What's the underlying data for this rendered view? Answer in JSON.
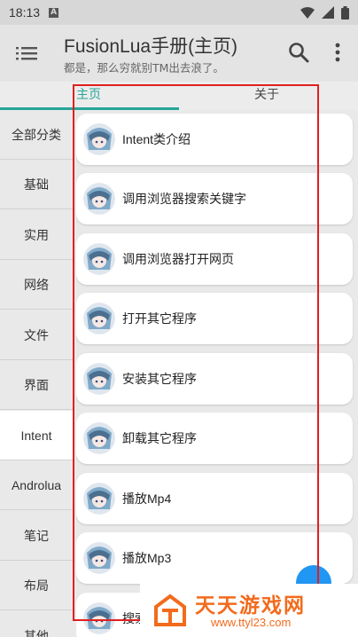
{
  "status_bar": {
    "time": "18:13",
    "sim_label": "A"
  },
  "app_bar": {
    "title": "FusionLua手册(主页)",
    "subtitle": "都是，那么穷就别TM出去浪了。"
  },
  "tabs": [
    {
      "label": "主页",
      "selected": true
    },
    {
      "label": "关于",
      "selected": false
    }
  ],
  "categories": [
    {
      "label": "全部分类"
    },
    {
      "label": "基础"
    },
    {
      "label": "实用"
    },
    {
      "label": "网络"
    },
    {
      "label": "文件"
    },
    {
      "label": "界面"
    },
    {
      "label": "Intent",
      "selected": true
    },
    {
      "label": "Androlua"
    },
    {
      "label": "笔记"
    },
    {
      "label": "布局"
    },
    {
      "label": "其他"
    }
  ],
  "items": [
    {
      "label": "Intent类介绍"
    },
    {
      "label": "调用浏览器搜索关键字"
    },
    {
      "label": "调用浏览器打开网页"
    },
    {
      "label": "打开其它程序"
    },
    {
      "label": "安装其它程序"
    },
    {
      "label": "卸载其它程序"
    },
    {
      "label": "播放Mp4"
    },
    {
      "label": "播放Mp3"
    },
    {
      "label": "搜索"
    }
  ],
  "watermark": {
    "name": "天天游戏网",
    "url": "www.ttyl23.com"
  },
  "colors": {
    "accent": "#26a69a",
    "highlight": "#e02020",
    "watermark": "#f26b1d"
  }
}
